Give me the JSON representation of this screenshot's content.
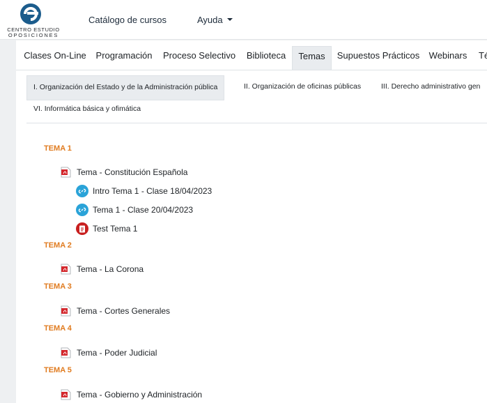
{
  "brand": {
    "line1": "CENTRO ESTUDIO",
    "line2": "OPOSICIONES"
  },
  "nav": {
    "catalog": "Catálogo de cursos",
    "help": "Ayuda"
  },
  "tabs": [
    {
      "label": "Clases On-Line"
    },
    {
      "label": "Programación"
    },
    {
      "label": "Proceso Selectivo"
    },
    {
      "label": "Biblioteca"
    },
    {
      "label": "Temas",
      "active": true
    },
    {
      "label": "Supuestos Prácticos"
    },
    {
      "label": "Webinars"
    },
    {
      "label": "Té"
    }
  ],
  "subtabs": [
    {
      "label": "I. Organización del Estado y de la Administración pública",
      "active": true
    },
    {
      "label": "II. Organización de oficinas públicas"
    },
    {
      "label": "III. Derecho administrativo gen"
    },
    {
      "label": "VI. Informática básica y ofimática"
    }
  ],
  "temas": [
    {
      "heading": "TEMA 1",
      "items": [
        {
          "type": "pdf",
          "label": "Tema - Constitución Española"
        },
        {
          "type": "link",
          "label": "Intro Tema 1 - Clase 18/04/2023"
        },
        {
          "type": "link",
          "label": "Tema 1 - Clase 20/04/2023"
        },
        {
          "type": "test",
          "label": "Test Tema 1"
        }
      ]
    },
    {
      "heading": "TEMA 2",
      "items": [
        {
          "type": "pdf",
          "label": "Tema - La Corona"
        }
      ]
    },
    {
      "heading": "TEMA 3",
      "items": [
        {
          "type": "pdf",
          "label": "Tema - Cortes Generales"
        }
      ]
    },
    {
      "heading": "TEMA 4",
      "items": [
        {
          "type": "pdf",
          "label": "Tema - Poder Judicial"
        }
      ]
    },
    {
      "heading": "TEMA 5",
      "items": [
        {
          "type": "pdf",
          "label": "Tema - Gobierno y Administración"
        }
      ]
    }
  ],
  "colors": {
    "accent_orange": "#e07b1f",
    "link_icon": "#2aa3d8",
    "test_icon": "#c81f1f",
    "brand_blue": "#1b5c8c"
  },
  "icons": {
    "pdf": "pdf-file-icon",
    "link": "url-link-icon",
    "test": "quiz-icon",
    "dropdown": "caret-down-icon"
  }
}
